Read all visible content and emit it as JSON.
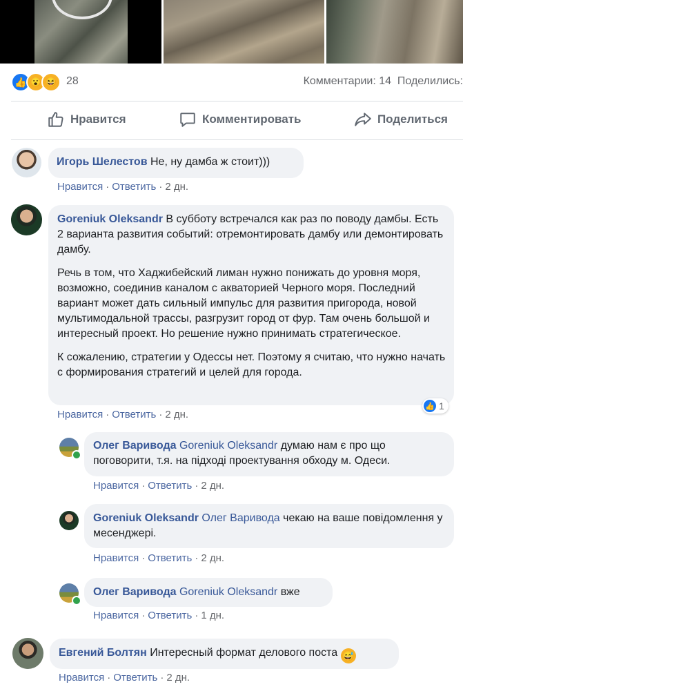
{
  "reactions": {
    "count": "28",
    "comments_label": "Комментарии: 14",
    "shares_label": "Поделились:"
  },
  "actions": {
    "like": "Нравится",
    "comment": "Комментировать",
    "share": "Поделиться"
  },
  "comments": [
    {
      "author": "Игорь Шелестов",
      "text": "Не, ну дамба ж стоит)))",
      "like": "Нравится",
      "reply": "Ответить",
      "time": "2 дн."
    },
    {
      "author": "Goreniuk Oleksandr",
      "p1": "В субботу встречался как раз по поводу дамбы. Есть 2 варианта развития событий: отремонтировать дамбу или демонтировать дамбу.",
      "p2": "Речь в том, что Хаджибейский лиман нужно понижать до уровня моря, возможно, соединив каналом с акваторией Черного моря. Последний вариант может дать сильный импульс для развития пригорода, новой мультимодальной трассы, разгрузит город от фур. Там очень большой и интересный проект. Но решение нужно принимать стратегическое.",
      "p3": "К сожалению, стратегии у Одессы нет. Поэтому я считаю, что нужно начать с формирования стратегий и целей для города.",
      "like_count": "1",
      "like": "Нравится",
      "reply": "Ответить",
      "time": "2 дн."
    },
    {
      "author": "Олег Варивода",
      "mention": "Goreniuk Oleksandr",
      "text": "думаю нам є про що поговорити, т.я. на підході проектування обходу м. Одеси.",
      "like": "Нравится",
      "reply": "Ответить",
      "time": "2 дн."
    },
    {
      "author": "Goreniuk Oleksandr",
      "mention": "Олег Варивода",
      "text": "чекаю на ваше повідомлення у месенджері.",
      "like": "Нравится",
      "reply": "Ответить",
      "time": "2 дн."
    },
    {
      "author": "Олег Варивода",
      "mention": "Goreniuk Oleksandr",
      "text": "вже",
      "like": "Нравится",
      "reply": "Ответить",
      "time": "1 дн."
    },
    {
      "author": "Евгений Болтян",
      "text": "Интересный формат делового поста",
      "like": "Нравится",
      "reply": "Ответить",
      "time": "2 дн."
    }
  ]
}
